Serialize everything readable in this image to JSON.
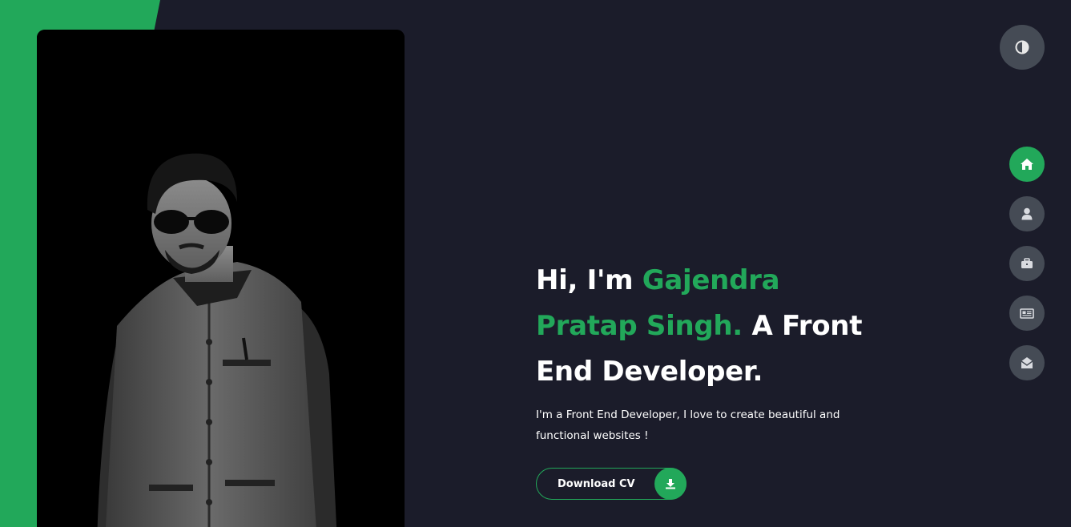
{
  "theme": {
    "background": "#1b1c2a",
    "accent": "#22a85a",
    "button_gray": "#454b55",
    "text": "#ffffff"
  },
  "theme_toggle": {
    "icon": "contrast-icon"
  },
  "nav": [
    {
      "id": "home",
      "icon": "home-icon",
      "active": true
    },
    {
      "id": "about",
      "icon": "user-icon",
      "active": false
    },
    {
      "id": "portfolio",
      "icon": "briefcase-icon",
      "active": false
    },
    {
      "id": "blog",
      "icon": "newspaper-icon",
      "active": false
    },
    {
      "id": "contact",
      "icon": "envelope-open-icon",
      "active": false
    }
  ],
  "hero": {
    "greeting": "Hi, I'm",
    "name": "Gajendra Pratap Singh.",
    "role": "A Front End Developer.",
    "description": "I'm a Front End Developer, I love to create beautiful and functional websites !",
    "cta_label": "Download CV",
    "cta_icon": "download-icon"
  },
  "portrait": {
    "icon": "person-photo"
  }
}
